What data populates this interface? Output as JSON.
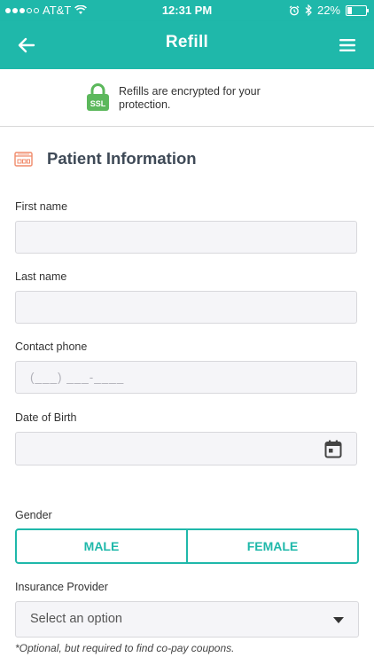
{
  "status_bar": {
    "carrier": "AT&T",
    "time": "12:31 PM",
    "battery": "22%"
  },
  "nav": {
    "title": "Refill",
    "back_icon": "arrow-left",
    "menu_icon": "hamburger"
  },
  "ssl": {
    "badge": "SSL",
    "message": "Refills are encrypted for your protection."
  },
  "section": {
    "title": "Patient Information",
    "icon": "card-icon"
  },
  "form": {
    "first_name": {
      "label": "First name",
      "value": ""
    },
    "last_name": {
      "label": "Last name",
      "value": ""
    },
    "contact_phone": {
      "label": "Contact phone",
      "placeholder": "(___) ___-____"
    },
    "dob": {
      "label": "Date of Birth",
      "value": ""
    },
    "gender": {
      "label": "Gender",
      "options": [
        "MALE",
        "FEMALE"
      ]
    },
    "insurance": {
      "label": "Insurance Provider",
      "selected": "Select an option",
      "note": "*Optional, but required to find co-pay coupons."
    }
  },
  "colors": {
    "brand": "#1fb8aa",
    "ssl_green": "#5cb85c",
    "icon_orange": "#f08a6a"
  }
}
